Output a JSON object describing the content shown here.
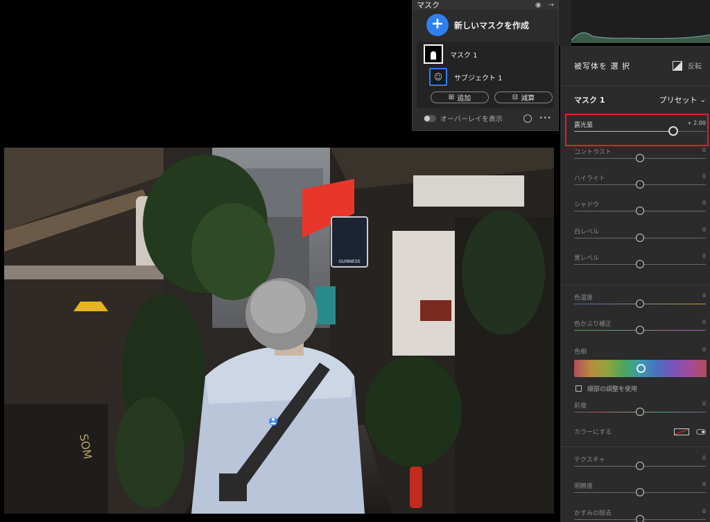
{
  "mask_panel": {
    "title": "マスク",
    "new_mask_label": "新しいマスクを作成",
    "masks": [
      {
        "name": "マスク 1"
      },
      {
        "name": "サブジェクト 1"
      }
    ],
    "add_label": "追加",
    "subtract_label": "減算",
    "overlay_label": "オーバーレイを表示",
    "more_label": "•••"
  },
  "right_panel": {
    "select_subject_label": "被写体を 選 択",
    "invert_label": "反転",
    "mask_name": "マスク 1",
    "presets_label": "プリセット",
    "sliders": [
      {
        "label": "露光量",
        "value": "+ 2.00",
        "position": 0.75,
        "active": true
      },
      {
        "label": "コントラスト",
        "value": "0",
        "position": 0.5
      },
      {
        "label": "ハイライト",
        "value": "0",
        "position": 0.5
      },
      {
        "label": "シャドウ",
        "value": "0",
        "position": 0.5
      },
      {
        "label": "白レベル",
        "value": "0",
        "position": 0.5
      },
      {
        "label": "黒レベル",
        "value": "0",
        "position": 0.5
      },
      {
        "label": "色温度",
        "value": "0",
        "position": 0.5,
        "gradient": "temp"
      },
      {
        "label": "色かぶり補正",
        "value": "0",
        "position": 0.5,
        "gradient": "tint"
      }
    ],
    "hue": {
      "label": "色相",
      "value": "0",
      "position": 0.5
    },
    "fine_adjust_label": "細部の調整を使用",
    "saturation": {
      "label": "彩度",
      "value": "0",
      "position": 0.5
    },
    "colorize_label": "カラーにする",
    "sliders_lower": [
      {
        "label": "テクスチャ",
        "value": "0",
        "position": 0.5
      },
      {
        "label": "明瞭度",
        "value": "0",
        "position": 0.5
      },
      {
        "label": "かすみの除去",
        "value": "0",
        "position": 0.5
      }
    ]
  },
  "photo": {
    "sign_text": "GUINNESS",
    "shop_sign_text": "SOM"
  },
  "colors": {
    "accent": "#2f7ff0",
    "highlight": "#e0202a"
  }
}
